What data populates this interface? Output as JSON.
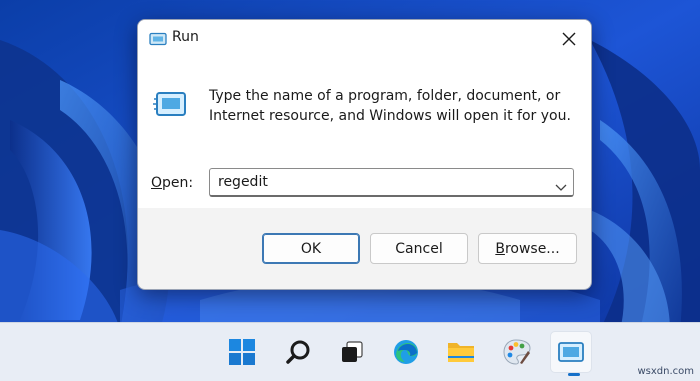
{
  "dialog": {
    "title": "Run",
    "description": "Type the name of a program, folder, document, or Internet resource, and Windows will open it for you.",
    "open_label_accel": "O",
    "open_label_rest": "pen:",
    "open_value": "regedit",
    "buttons": {
      "ok": "OK",
      "cancel": "Cancel",
      "browse_accel": "B",
      "browse_rest": "rowse..."
    }
  },
  "taskbar": {
    "items": [
      "start-icon",
      "search-icon",
      "task-view-icon",
      "edge-icon",
      "file-explorer-icon",
      "paint-icon",
      "run-icon"
    ],
    "active_item": "run-icon"
  },
  "watermark": "wsxdn.com",
  "colors": {
    "accent": "#1570c9",
    "wallpaper": "#1a3fb0",
    "dialog_footer": "#f3f3f3"
  }
}
